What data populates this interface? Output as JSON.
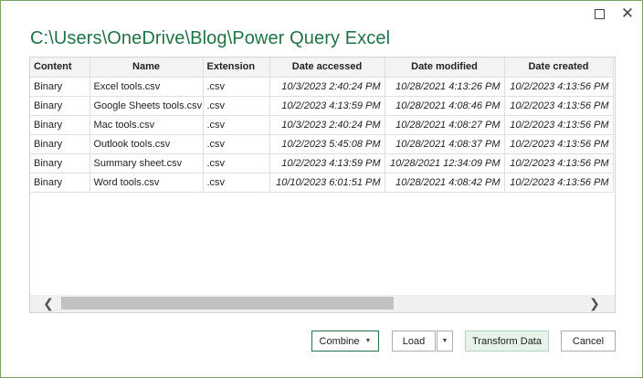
{
  "window": {
    "title": "C:\\Users\\OneDrive\\Blog\\Power Query Excel"
  },
  "table": {
    "columns": [
      "Content",
      "Name",
      "Extension",
      "Date accessed",
      "Date modified",
      "Date created"
    ],
    "rows": [
      [
        "Binary",
        "Excel tools.csv",
        ".csv",
        "10/3/2023 2:40:24 PM",
        "10/28/2021 4:13:26 PM",
        "10/2/2023 4:13:56 PM"
      ],
      [
        "Binary",
        "Google Sheets tools.csv",
        ".csv",
        "10/2/2023 4:13:59 PM",
        "10/28/2021 4:08:46 PM",
        "10/2/2023 4:13:56 PM"
      ],
      [
        "Binary",
        "Mac tools.csv",
        ".csv",
        "10/3/2023 2:40:24 PM",
        "10/28/2021 4:08:27 PM",
        "10/2/2023 4:13:56 PM"
      ],
      [
        "Binary",
        "Outlook tools.csv",
        ".csv",
        "10/2/2023 5:45:08 PM",
        "10/28/2021 4:08:37 PM",
        "10/2/2023 4:13:56 PM"
      ],
      [
        "Binary",
        "Summary sheet.csv",
        ".csv",
        "10/2/2023 4:13:59 PM",
        "10/28/2021 12:34:09 PM",
        "10/2/2023 4:13:56 PM"
      ],
      [
        "Binary",
        "Word tools.csv",
        ".csv",
        "10/10/2023 6:01:51 PM",
        "10/28/2021 4:08:42 PM",
        "10/2/2023 4:13:56 PM"
      ]
    ]
  },
  "buttons": {
    "combine": "Combine",
    "load": "Load",
    "transform": "Transform Data",
    "cancel": "Cancel"
  },
  "icons": {
    "maximize": "maximize-icon",
    "close": "close-icon",
    "scroll_left": "chevron-left-icon",
    "scroll_right": "chevron-right-icon",
    "dropdown": "caret-down-icon"
  },
  "colors": {
    "accent": "#217346",
    "border": "#7aa35f",
    "transform_bg": "#e6f2ea"
  }
}
